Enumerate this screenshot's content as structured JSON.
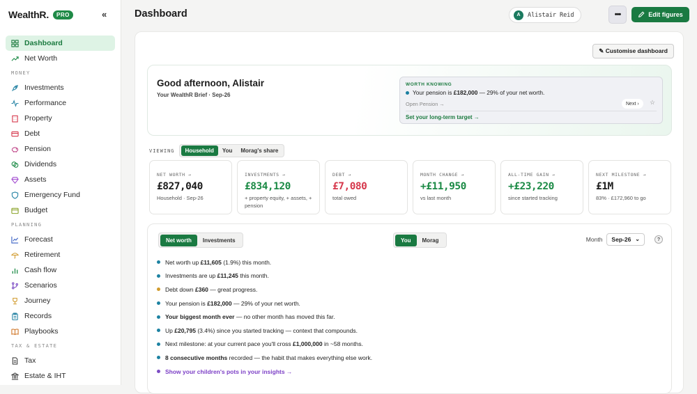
{
  "brand": {
    "name": "WealthR.",
    "badge": "PRO",
    "collapse": "«"
  },
  "nav": {
    "dashboard": "Dashboard",
    "net_worth": "Net Worth",
    "section_money": "MONEY",
    "investments": "Investments",
    "performance": "Performance",
    "property": "Property",
    "debt": "Debt",
    "pension": "Pension",
    "dividends": "Dividends",
    "assets": "Assets",
    "emergency_fund": "Emergency Fund",
    "budget": "Budget",
    "section_planning": "PLANNING",
    "forecast": "Forecast",
    "retirement": "Retirement",
    "cash_flow": "Cash flow",
    "scenarios": "Scenarios",
    "journey": "Journey",
    "records": "Records",
    "playbooks": "Playbooks",
    "section_tax": "TAX & ESTATE",
    "tax": "Tax",
    "estate": "Estate & IHT"
  },
  "header": {
    "title": "Dashboard",
    "user_initial": "A",
    "user_name": "Alistair Reid",
    "more": "•••",
    "edit": "Edit figures"
  },
  "customise": "✎ Customise dashboard",
  "greeting": {
    "title": "Good afternoon, Alistair",
    "subtitle": "Your WealthR Brief · Sep-26"
  },
  "worth_knowing": {
    "label": "WORTH KNOWING",
    "text_pre": "Your pension is ",
    "text_bold": "£182,000",
    "text_post": " — 29% of your net worth.",
    "open": "Open Pension →",
    "next": "Next ›",
    "star": "☆",
    "target": "Set your long-term target →"
  },
  "viewing": {
    "label": "VIEWING",
    "options": [
      "Household",
      "You",
      "Morag's share"
    ]
  },
  "metrics": [
    {
      "label": "NET WORTH →",
      "value": "£827,040",
      "sub": "Household · Sep-26"
    },
    {
      "label": "INVESTMENTS →",
      "value": "£834,120",
      "sub": "+ property equity, + assets, + pension"
    },
    {
      "label": "DEBT →",
      "value": "£7,080",
      "sub": "total owed"
    },
    {
      "label": "MONTH CHANGE →",
      "value": "+£11,950",
      "sub": "vs last month"
    },
    {
      "label": "ALL-TIME GAIN →",
      "value": "+£23,220",
      "sub": "since started tracking"
    },
    {
      "label": "NEXT MILESTONE →",
      "value": "£1M",
      "sub": "83% · £172,960 to go"
    }
  ],
  "insights": {
    "tabs": [
      "Net worth",
      "Investments"
    ],
    "person_tabs": [
      "You",
      "Morag"
    ],
    "month_label": "Month",
    "month_value": "Sep-26",
    "month_chevron": "⌄",
    "help": "?",
    "b1": {
      "pre": "Net worth up ",
      "bold": "£11,605",
      "post": " (1.9%) this month."
    },
    "b2": {
      "pre": "Investments are up ",
      "bold": "£11,245",
      "post": " this month."
    },
    "b3": {
      "pre": "Debt down ",
      "bold": "£360",
      "post": " — great progress."
    },
    "b4": {
      "pre": "Your pension is ",
      "bold": "£182,000",
      "post": " — 29% of your net worth."
    },
    "b5": {
      "bold": "Your biggest month ever",
      "post": " — no other month has moved this far."
    },
    "b6": {
      "pre": "Up ",
      "bold": "£20,795",
      "post": " (3.4%) since you started tracking — context that compounds."
    },
    "b7": {
      "pre": "Next milestone: at your current pace you'll cross ",
      "bold": "£1,000,000",
      "post": " in ~58 months."
    },
    "b8": {
      "bold": "8 consecutive months",
      "post": " recorded — the habit that makes everything else work."
    },
    "b9": {
      "link": "Show your children's pots in your insights →"
    }
  },
  "colors": {
    "accent": "#1a7a42",
    "positive": "#1b8a45",
    "negative": "#d6384c",
    "link": "#7c3fc6"
  }
}
